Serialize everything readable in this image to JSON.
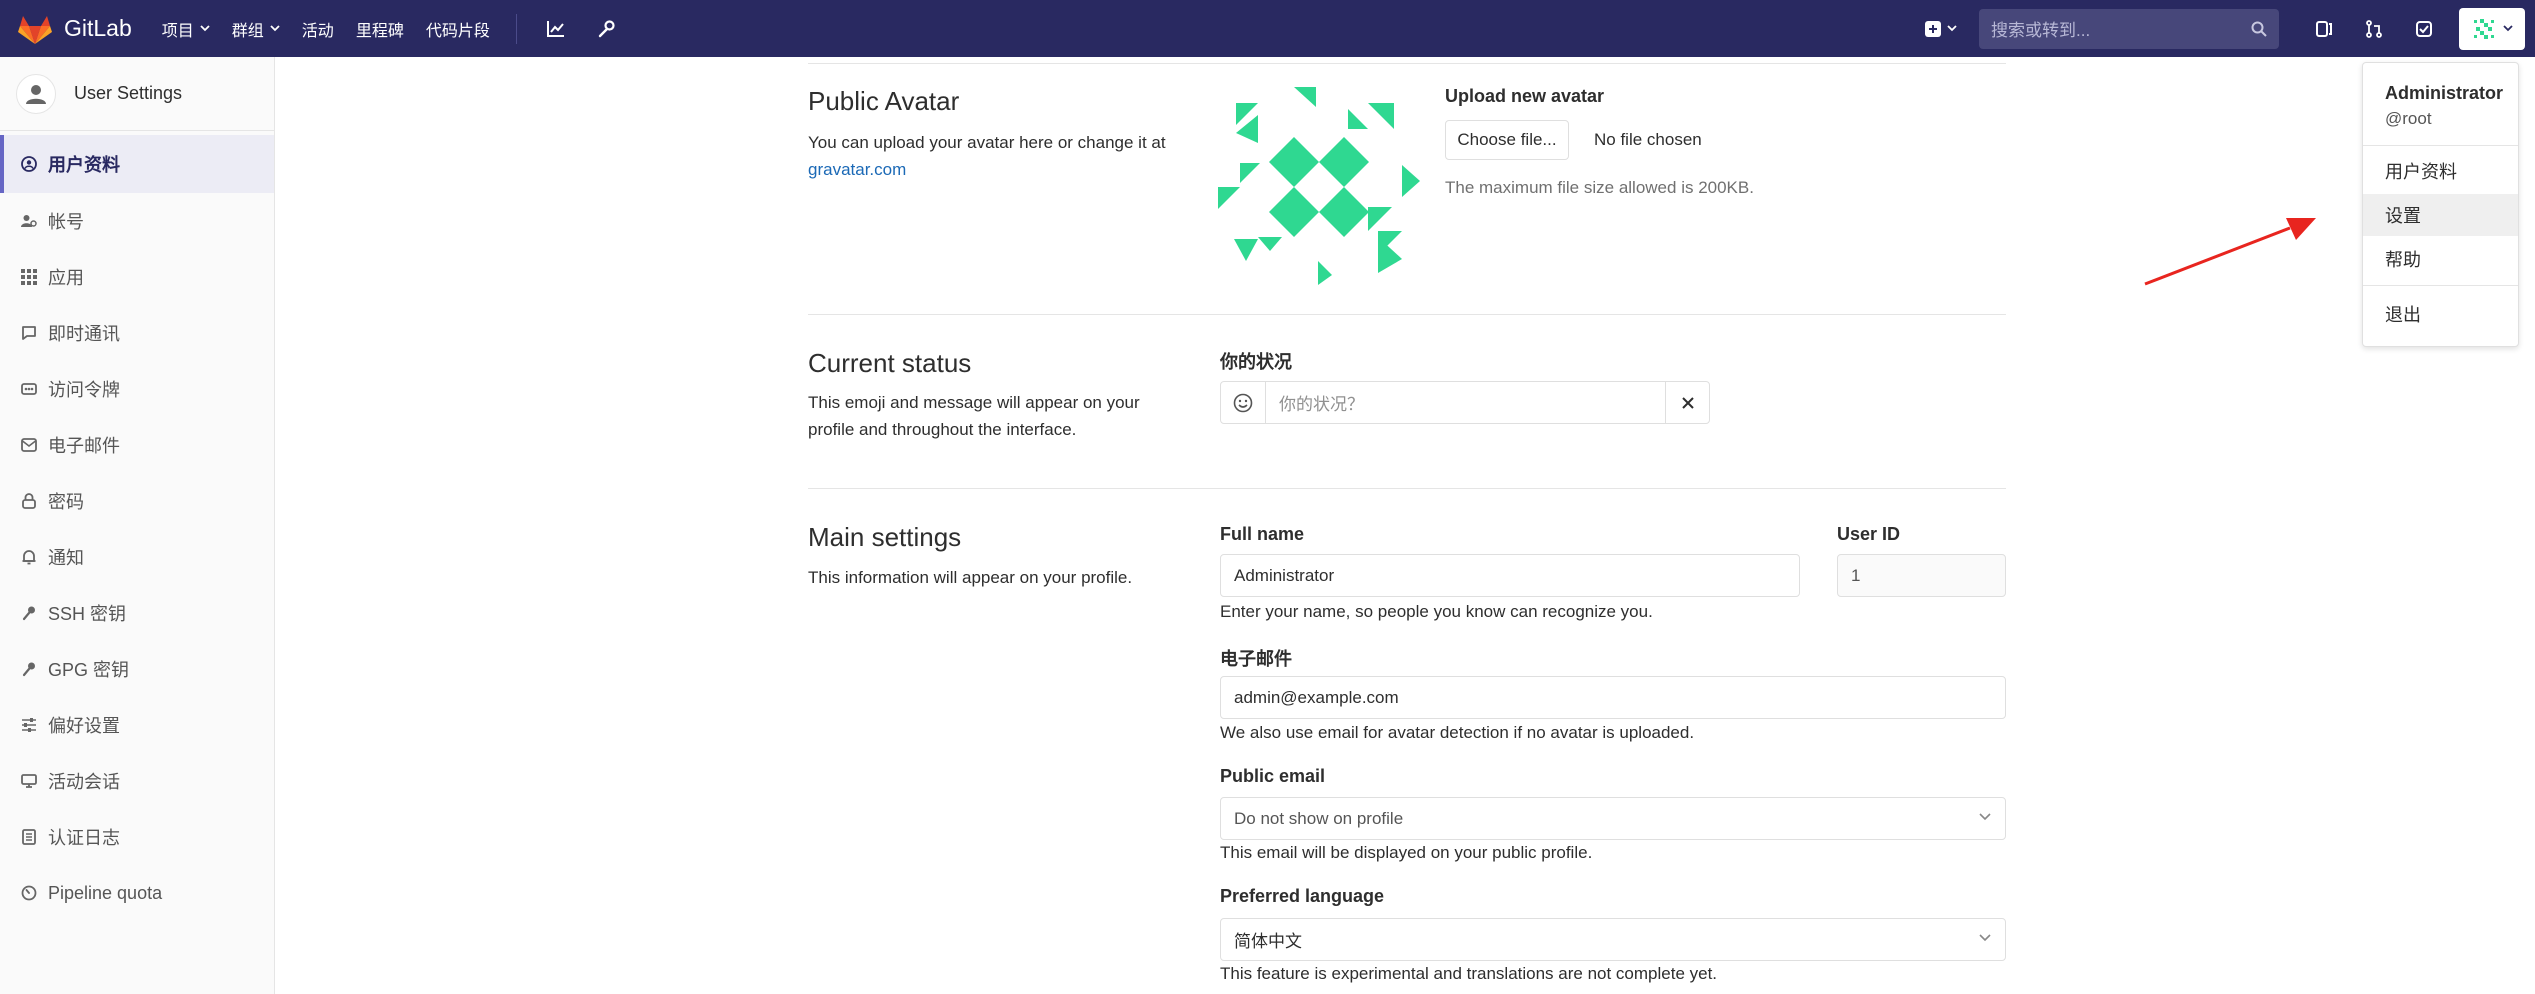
{
  "navbar": {
    "brand": "GitLab",
    "links": [
      "项目",
      "群组",
      "活动",
      "里程碑",
      "代码片段"
    ],
    "search_placeholder": "搜索或转到...",
    "bg": "#292961"
  },
  "sidebar": {
    "title": "User Settings",
    "items": [
      {
        "label": "用户资料",
        "icon": "profile-icon"
      },
      {
        "label": "帐号",
        "icon": "account-icon"
      },
      {
        "label": "应用",
        "icon": "applications-icon"
      },
      {
        "label": "即时通讯",
        "icon": "chat-icon"
      },
      {
        "label": "访问令牌",
        "icon": "token-icon"
      },
      {
        "label": "电子邮件",
        "icon": "mail-icon"
      },
      {
        "label": "密码",
        "icon": "lock-icon"
      },
      {
        "label": "通知",
        "icon": "bell-icon"
      },
      {
        "label": "SSH 密钥",
        "icon": "key-icon"
      },
      {
        "label": "GPG 密钥",
        "icon": "key-icon"
      },
      {
        "label": "偏好设置",
        "icon": "sliders-icon"
      },
      {
        "label": "活动会话",
        "icon": "monitor-icon"
      },
      {
        "label": "认证日志",
        "icon": "log-icon"
      },
      {
        "label": "Pipeline quota",
        "icon": "quota-icon"
      }
    ]
  },
  "avatar": {
    "title": "Public Avatar",
    "desc": "You can upload your avatar here or change it at",
    "link": "gravatar.com",
    "upload_label": "Upload new avatar",
    "choose_button": "Choose file...",
    "no_file": "No file chosen",
    "max_size": "The maximum file size allowed is 200KB."
  },
  "status": {
    "title": "Current status",
    "desc": "This emoji and message will appear on your profile and throughout the interface.",
    "label": "你的状况",
    "placeholder": "你的状况？"
  },
  "main": {
    "title": "Main settings",
    "desc": "This information will appear on your profile.",
    "full_name_label": "Full name",
    "full_name": "Administrator",
    "full_name_help": "Enter your name, so people you know can recognize you.",
    "user_id_label": "User ID",
    "user_id": "1",
    "email_label": "电子邮件",
    "email": "admin@example.com",
    "email_help": "We also use email for avatar detection if no avatar is uploaded.",
    "public_email_label": "Public email",
    "public_email": "Do not show on profile",
    "public_email_help": "This email will be displayed on your public profile.",
    "language_label": "Preferred language",
    "language": "简体中文",
    "language_help": "This feature is experimental and translations are not complete yet."
  },
  "dropdown": {
    "name": "Administrator",
    "username": "@root",
    "items": [
      "用户资料",
      "设置",
      "帮助",
      "退出"
    ]
  },
  "colors": {
    "accent": "#6666c4",
    "avatar_green": "#2fd891",
    "arrow": "#e8251f"
  }
}
